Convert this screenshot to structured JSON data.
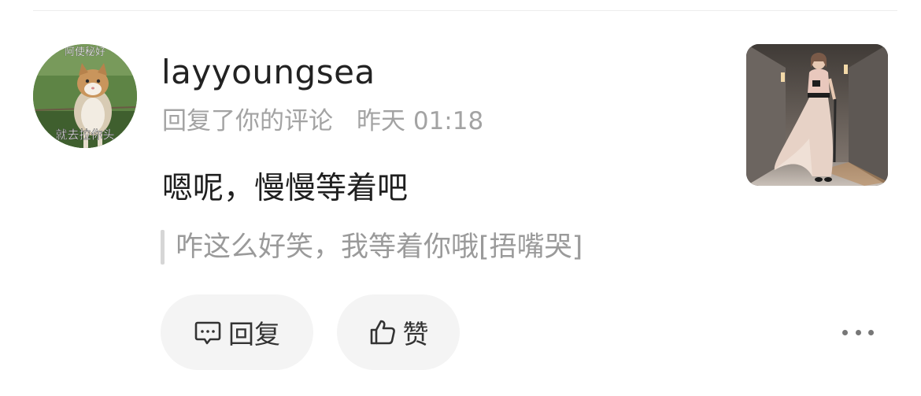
{
  "comment": {
    "username": "layyoungsea",
    "action_text": "回复了你的评论",
    "timestamp": "昨天 01:18",
    "reply_text": "嗯呢，慢慢等着吧",
    "quoted_text": "咋这么好笑，我等着你哦[捂嘴哭]",
    "avatar": {
      "icon": "cat-meme-avatar",
      "top_caption": "阿使秘好",
      "bottom_caption": "就去拉你头"
    },
    "thumbnail": {
      "icon": "fashion-photo-thumbnail"
    }
  },
  "actions": {
    "reply_label": "回复",
    "like_label": "赞",
    "reply_icon": "comment-bubble-icon",
    "like_icon": "thumbs-up-icon",
    "more_icon": "more-dots-icon"
  },
  "colors": {
    "text_primary": "#222222",
    "text_secondary": "#a3a3a3",
    "pill_background": "#f4f4f4"
  }
}
